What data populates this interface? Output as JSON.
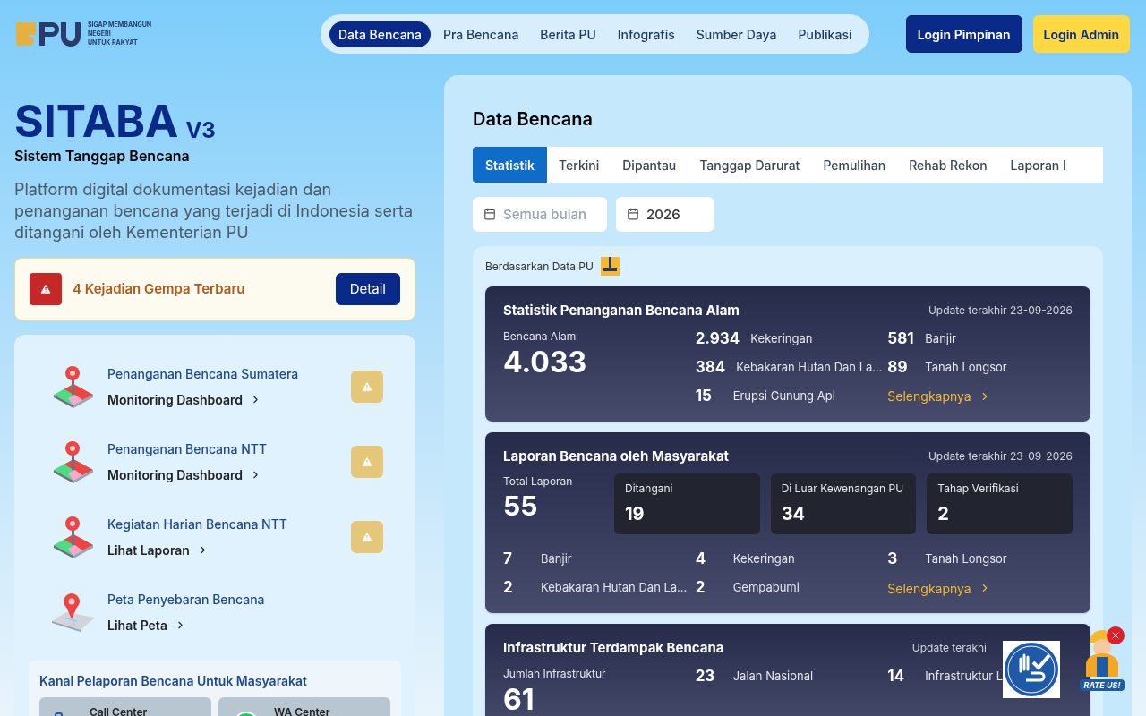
{
  "logo": {
    "tagline": [
      "SIGAP MEMBANGUN",
      "NEGERI",
      "UNTUK RAKYAT"
    ]
  },
  "nav": [
    {
      "label": "Data Bencana",
      "selected": true
    },
    {
      "label": "Pra Bencana",
      "selected": false
    },
    {
      "label": "Berita PU",
      "selected": false
    },
    {
      "label": "Infografis",
      "selected": false
    },
    {
      "label": "Sumber Daya",
      "selected": false
    },
    {
      "label": "Publikasi",
      "selected": false
    }
  ],
  "login_buttons": [
    {
      "label": "Login Pimpinan",
      "kind": "dark"
    },
    {
      "label": "Login Admin",
      "kind": "yellow"
    }
  ],
  "hero": {
    "title": "SITABA",
    "version": "V3",
    "subtitle": "Sistem Tanggap Bencana",
    "description": "Platform digital dokumentasi kejadian dan penanganan bencana yang terjadi di Indonesia serta ditangani oleh Kementerian PU"
  },
  "alert": {
    "text": "4 Kejadian Gempa Terbaru",
    "button": "Detail"
  },
  "menu": [
    {
      "title": "Penanganan Bencana Sumatera",
      "link": "Monitoring Dashboard",
      "kind": "pin",
      "warning": true
    },
    {
      "title": "Penanganan Bencana NTT",
      "link": "Monitoring Dashboard",
      "kind": "pin",
      "warning": true
    },
    {
      "title": "Kegiatan Harian Bencana NTT",
      "link": "Lihat Laporan",
      "kind": "pin",
      "warning": true
    },
    {
      "title": "Peta Penyebaran Bencana",
      "link": "Lihat Peta",
      "kind": "map",
      "warning": false
    }
  ],
  "channels": {
    "title": "Kanal Pelaporan Bencana Untuk Masyarakat",
    "items": [
      {
        "label": "Call Center",
        "kind": "phone"
      },
      {
        "label": "WA Center",
        "kind": "whatsapp"
      }
    ]
  },
  "panel": {
    "title": "Data Bencana",
    "tabs": [
      {
        "label": "Statistik",
        "selected": true
      },
      {
        "label": "Terkini",
        "selected": false
      },
      {
        "label": "Dipantau",
        "selected": false
      },
      {
        "label": "Tanggap Darurat",
        "selected": false
      },
      {
        "label": "Pemulihan",
        "selected": false
      },
      {
        "label": "Rehab Rekon",
        "selected": false
      },
      {
        "label": "Laporan I",
        "selected": false
      }
    ],
    "filters": [
      {
        "placeholder": "Semua bulan"
      },
      {
        "value": "2026"
      }
    ],
    "source": "Berdasarkan Data PU",
    "cards": [
      {
        "title": "Statistik Penanganan Bencana Alam",
        "update": "Update terakhir 23-09-2026",
        "main_label": "Bencana Alam",
        "main_value": "4.033",
        "columns": [
          [
            {
              "value": "2.934",
              "label": "Kekeringan"
            },
            {
              "value": "384",
              "label": "Kebakaran Hutan Dan La..."
            },
            {
              "value": "15",
              "label": "Erupsi Gunung Api"
            }
          ],
          [
            {
              "value": "581",
              "label": "Banjir"
            },
            {
              "value": "89",
              "label": "Tanah Longsor"
            }
          ]
        ],
        "link": "Selengkapnya"
      },
      {
        "title": "Laporan Bencana oleh Masyarakat",
        "update": "Update terakhir 23-09-2026",
        "main_label": "Total Laporan",
        "main_value": "55",
        "boxes": [
          {
            "label": "Ditangani",
            "value": "19"
          },
          {
            "label": "Di Luar Kewenangan PU",
            "value": "34"
          },
          {
            "label": "Tahap Verifikasi",
            "value": "2"
          }
        ],
        "columns": [
          [
            {
              "value": "7",
              "label": "Banjir"
            },
            {
              "value": "2",
              "label": "Kebakaran Hutan Dan La..."
            }
          ],
          [
            {
              "value": "4",
              "label": "Kekeringan"
            },
            {
              "value": "2",
              "label": "Gempabumi"
            }
          ],
          [
            {
              "value": "3",
              "label": "Tanah Longsor"
            }
          ]
        ],
        "link": "Selengkapnya"
      },
      {
        "title": "Infrastruktur Terdampak Bencana",
        "update": "Update terakhi",
        "main_label": "Jumlah Infrastruktur",
        "main_value": "61",
        "columns": [
          [
            {
              "value": "23",
              "label": "Jalan Nasional"
            }
          ],
          [
            {
              "value": "14",
              "label": "Infrastruktur L"
            }
          ]
        ]
      }
    ]
  },
  "rate_badge": {
    "label": "RATE US!"
  }
}
